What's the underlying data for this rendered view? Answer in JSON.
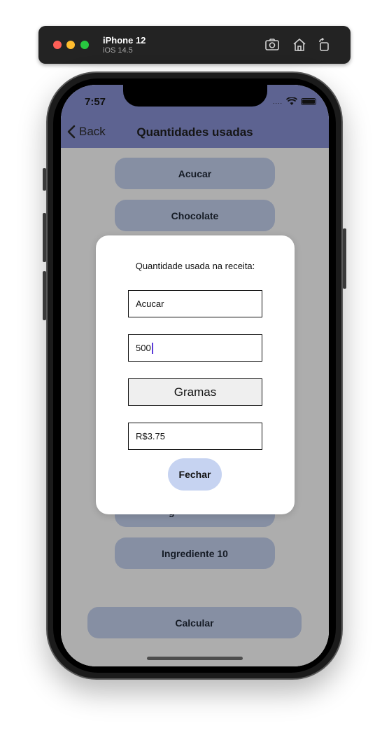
{
  "simulator": {
    "device_name": "iPhone 12",
    "os_version": "iOS 14.5",
    "icons": [
      "screenshot-icon",
      "home-icon",
      "rotate-icon"
    ]
  },
  "status_bar": {
    "time": "7:57",
    "signal": "....",
    "icons": [
      "wifi-icon",
      "battery-icon"
    ]
  },
  "navbar": {
    "back_label": "Back",
    "title": "Quantidades usadas",
    "background": "#8a93d6"
  },
  "ingredients": {
    "first": "Acucar",
    "second": "Chocolate",
    "ninth_partial": "g",
    "tenth": "Ingrediente 10"
  },
  "calculate_label": "Calcular",
  "modal": {
    "title": "Quantidade usada na receita:",
    "ingredient_value": "Acucar",
    "quantity_value": "500",
    "unit_value": "Gramas",
    "price_value": "R$3.75",
    "close_label": "Fechar"
  },
  "colors": {
    "button_background": "#c6d3f1",
    "overlay": "rgba(0,0,0,0.32)"
  }
}
